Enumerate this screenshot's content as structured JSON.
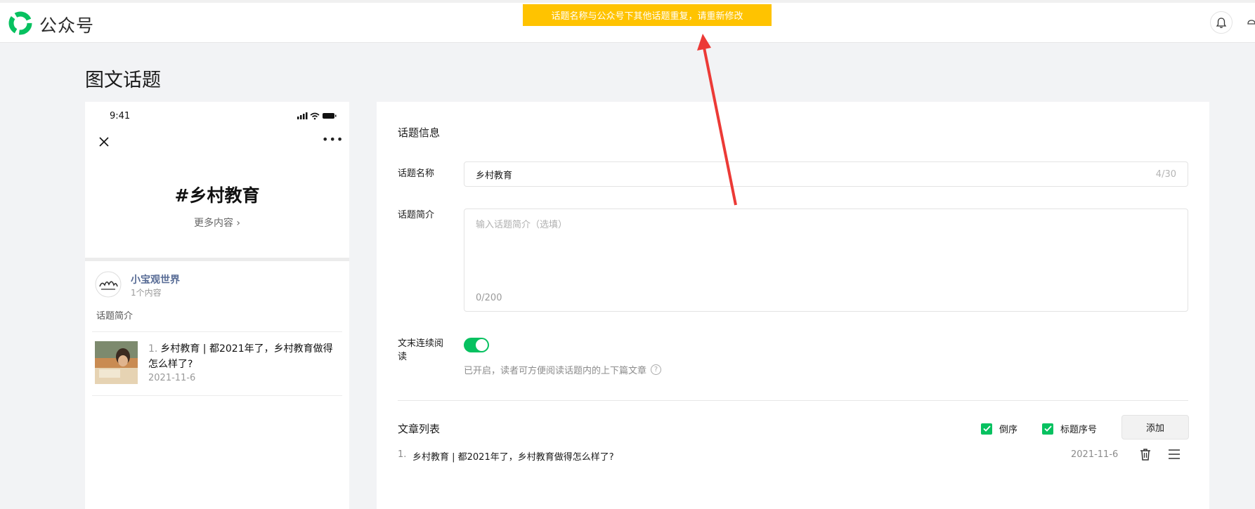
{
  "topbar": {
    "brand": "公众号",
    "toast": "话题名称与公众号下其他话题重复，请重新修改"
  },
  "page": {
    "title": "图文话题"
  },
  "preview": {
    "status_time": "9:41",
    "topic_title": "#乡村教育",
    "more_content": "更多内容 ›",
    "account_name": "小宝观世界",
    "account_count": "1个内容",
    "intro_label": "话题简介",
    "article": {
      "num": "1.",
      "title": "乡村教育 | 都2021年了，乡村教育做得怎么样了?",
      "date": "2021-11-6"
    }
  },
  "form": {
    "section_title": "话题信息",
    "name_label": "话题名称",
    "name_value": "乡村教育",
    "name_counter": "4/30",
    "intro_label": "话题简介",
    "intro_placeholder": "输入话题简介（选填）",
    "intro_counter": "0/200",
    "continuous_label_1": "文末连续阅",
    "continuous_label_2": "读",
    "continuous_enabled": true,
    "continuous_desc": "已开启，读者可方便阅读话题内的上下篇文章",
    "help_glyph": "?"
  },
  "article_list": {
    "title": "文章列表",
    "reverse_label": "倒序",
    "reverse_checked": true,
    "numbering_label": "标题序号",
    "numbering_checked": true,
    "add_label": "添加",
    "rows": [
      {
        "num": "1.",
        "title": "乡村教育 | 都2021年了，乡村教育做得怎么样了?",
        "date": "2021-11-6"
      }
    ]
  },
  "colors": {
    "brand_green": "#07c160",
    "toast_yellow": "#ffc300",
    "annotation_red": "#ec3a36",
    "account_link": "#576b95"
  }
}
